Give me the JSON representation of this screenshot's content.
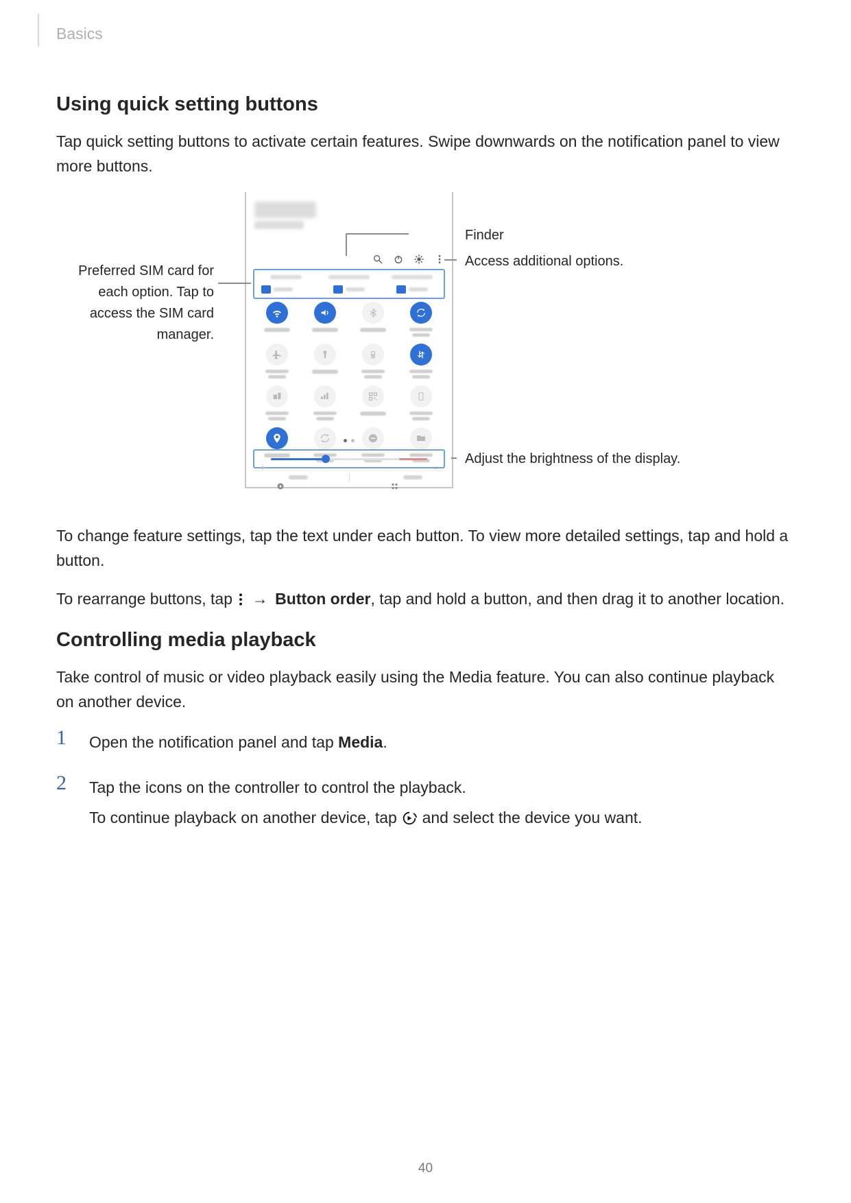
{
  "header": {
    "section": "Basics"
  },
  "h2a": "Using quick setting buttons",
  "p1": "Tap quick setting buttons to activate certain features. Swipe downwards on the notification panel to view more buttons.",
  "callouts": {
    "finder": "Finder",
    "options": "Access additional options.",
    "sim": "Preferred SIM card for each option. Tap to access the SIM card manager.",
    "brightness": "Adjust the brightness of the display."
  },
  "p2": "To change feature settings, tap the text under each button. To view more detailed settings, tap and hold a button.",
  "p3a": "To rearrange buttons, tap ",
  "p3b": " → ",
  "p3c": "Button order",
  "p3d": ", tap and hold a button, and then drag it to another location.",
  "h2b": "Controlling media playback",
  "p4": "Take control of music or video playback easily using the Media feature. You can also continue playback on another device.",
  "steps": {
    "s1": {
      "num": "1",
      "a": "Open the notification panel and tap ",
      "b": "Media",
      "c": "."
    },
    "s2": {
      "num": "2",
      "a": "Tap the icons on the controller to control the playback.",
      "cont_a": "To continue playback on another device, tap ",
      "cont_b": " and select the device you want."
    }
  },
  "page_number": "40",
  "quick_settings": {
    "tiles": [
      "wifi",
      "sound",
      "bluetooth",
      "auto-rotate",
      "flight-mode",
      "flashlight",
      "power-saving",
      "mobile-data",
      "mobile-hotspot",
      "performance",
      "qr-scanner",
      "dark-mode",
      "location",
      "sync",
      "dnd",
      "secure-folder"
    ],
    "active_indices": [
      0,
      1,
      3,
      7,
      12
    ]
  }
}
